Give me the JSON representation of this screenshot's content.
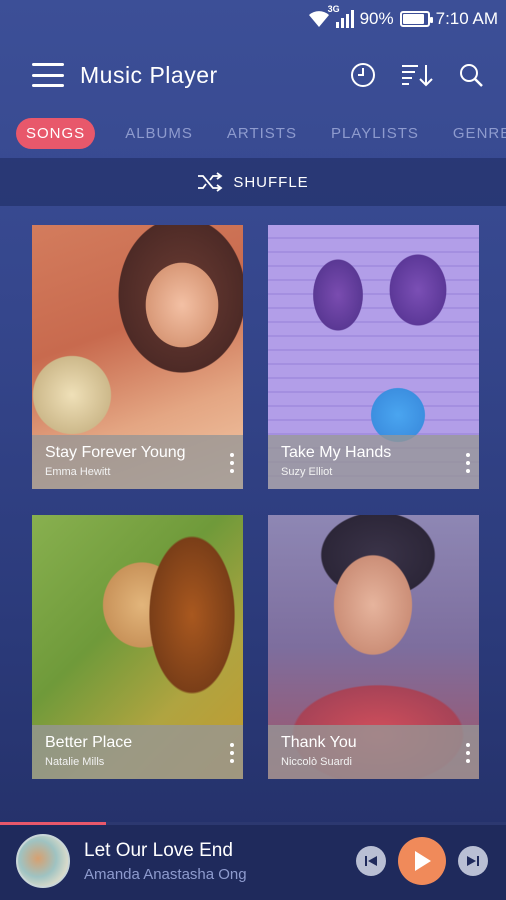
{
  "status_bar": {
    "network": "3G",
    "battery_percent": "90%",
    "battery_level": 0.9,
    "time": "7:10 AM"
  },
  "app_bar": {
    "title": "Music Player"
  },
  "tabs": [
    {
      "label": "SONGS",
      "active": true
    },
    {
      "label": "ALBUMS",
      "active": false
    },
    {
      "label": "ARTISTS",
      "active": false
    },
    {
      "label": "PLAYLISTS",
      "active": false
    },
    {
      "label": "GENRES",
      "active": false
    }
  ],
  "shuffle": {
    "label": "SHUFFLE"
  },
  "songs": [
    {
      "title": "Stay Forever Young",
      "artist": "Emma Hewitt"
    },
    {
      "title": "Take My Hands",
      "artist": "Suzy Elliot"
    },
    {
      "title": "Better Place",
      "artist": "Natalie Mills"
    },
    {
      "title": "Thank You",
      "artist": "Niccolò Suardi"
    }
  ],
  "now_playing": {
    "title": "Let Our Love End",
    "artist": "Amanda Anastasha Ong",
    "progress": 0.21
  },
  "colors": {
    "accent": "#e8586b",
    "play_button": "#f08a5a",
    "tab_inactive": "#8e9bce"
  }
}
